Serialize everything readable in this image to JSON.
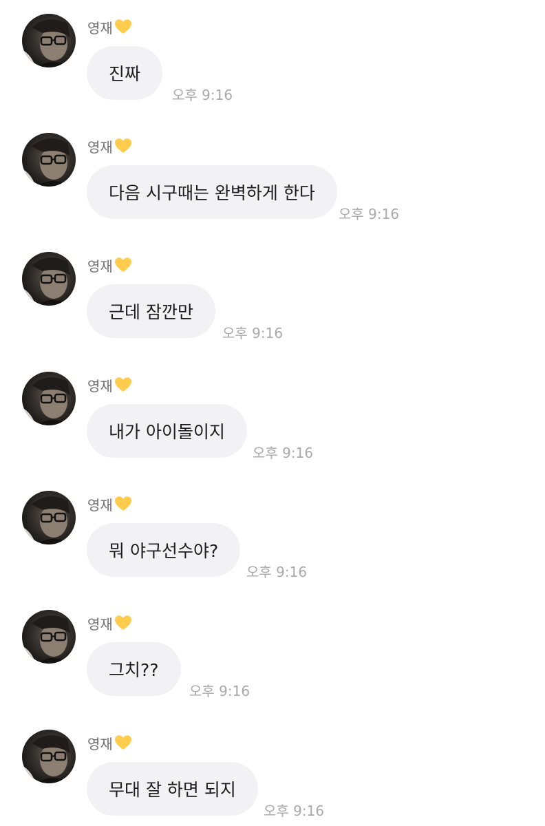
{
  "contact": {
    "name": "영재",
    "heart_icon": "yellow-heart-icon",
    "heart_color": "#FFCC4D"
  },
  "colors": {
    "bubble": "#F2F2F5",
    "text": "#1C1C1E",
    "name": "#6E6E73",
    "timestamp": "#A9A9AD"
  },
  "messages": [
    {
      "text": "진짜",
      "time": "오후 9:16"
    },
    {
      "text": "다음 시구때는 완벽하게 한다",
      "time": "오후 9:16"
    },
    {
      "text": "근데 잠깐만",
      "time": "오후 9:16"
    },
    {
      "text": "내가 아이돌이지",
      "time": "오후 9:16"
    },
    {
      "text": "뭐 야구선수야?",
      "time": "오후 9:16"
    },
    {
      "text": "그치??",
      "time": "오후 9:16"
    },
    {
      "text": "무대 잘 하면 되지",
      "time": "오후 9:16"
    }
  ]
}
